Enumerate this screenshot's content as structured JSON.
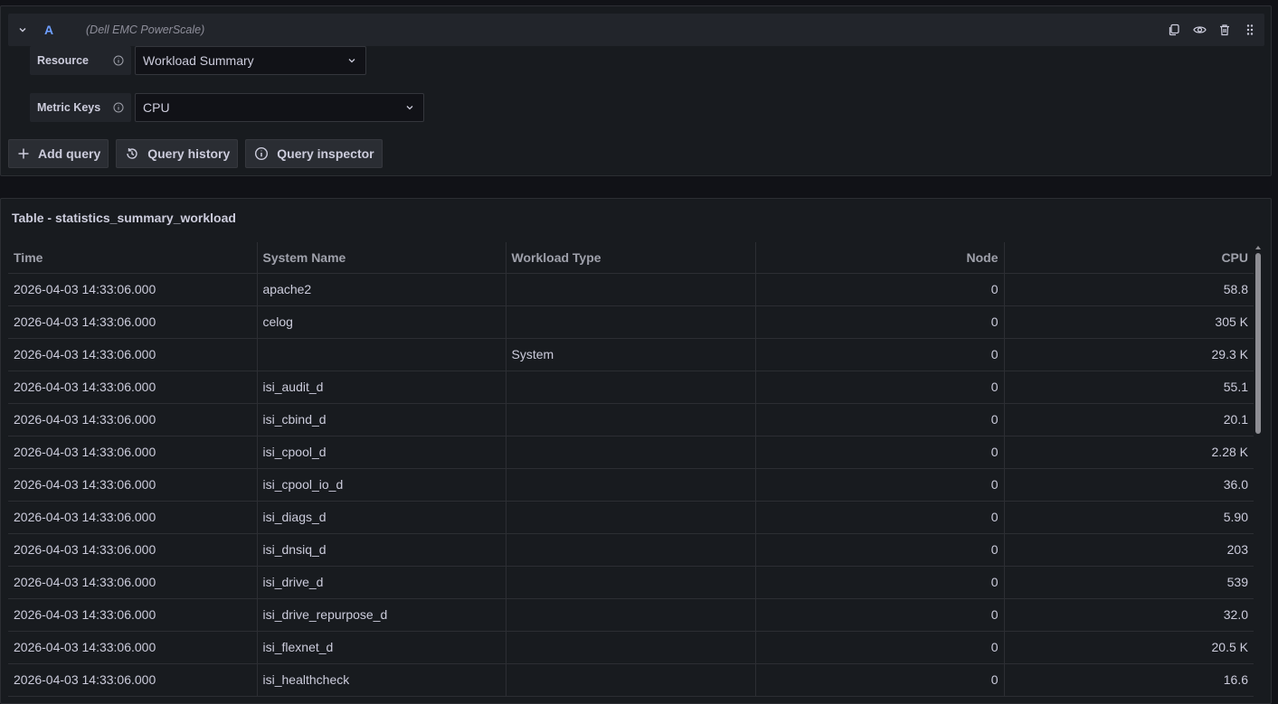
{
  "query": {
    "letter": "A",
    "datasource": "(Dell EMC PowerScale)",
    "fields": [
      {
        "label": "Resource",
        "value": "Workload Summary"
      },
      {
        "label": "Metric Keys",
        "value": "CPU"
      }
    ],
    "buttons": {
      "add_query": "Add query",
      "query_history": "Query history",
      "query_inspector": "Query inspector"
    }
  },
  "table": {
    "title": "Table - statistics_summary_workload",
    "columns": [
      "Time",
      "System Name",
      "Workload Type",
      "Node",
      "CPU"
    ],
    "rows": [
      [
        "2026-04-03 14:33:06.000",
        "apache2",
        "",
        "0",
        "58.8"
      ],
      [
        "2026-04-03 14:33:06.000",
        "celog",
        "",
        "0",
        "305 K"
      ],
      [
        "2026-04-03 14:33:06.000",
        "",
        "System",
        "0",
        "29.3 K"
      ],
      [
        "2026-04-03 14:33:06.000",
        "isi_audit_d",
        "",
        "0",
        "55.1"
      ],
      [
        "2026-04-03 14:33:06.000",
        "isi_cbind_d",
        "",
        "0",
        "20.1"
      ],
      [
        "2026-04-03 14:33:06.000",
        "isi_cpool_d",
        "",
        "0",
        "2.28 K"
      ],
      [
        "2026-04-03 14:33:06.000",
        "isi_cpool_io_d",
        "",
        "0",
        "36.0"
      ],
      [
        "2026-04-03 14:33:06.000",
        "isi_diags_d",
        "",
        "0",
        "5.90"
      ],
      [
        "2026-04-03 14:33:06.000",
        "isi_dnsiq_d",
        "",
        "0",
        "203"
      ],
      [
        "2026-04-03 14:33:06.000",
        "isi_drive_d",
        "",
        "0",
        "539"
      ],
      [
        "2026-04-03 14:33:06.000",
        "isi_drive_repurpose_d",
        "",
        "0",
        "32.0"
      ],
      [
        "2026-04-03 14:33:06.000",
        "isi_flexnet_d",
        "",
        "0",
        "20.5 K"
      ],
      [
        "2026-04-03 14:33:06.000",
        "isi_healthcheck",
        "",
        "0",
        "16.6"
      ]
    ]
  }
}
